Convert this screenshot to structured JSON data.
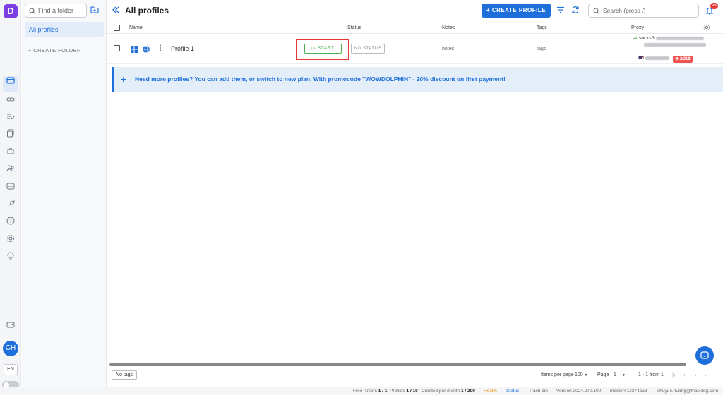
{
  "app": {
    "logo_letter": "D",
    "accent": "#1e6fd9"
  },
  "sidebar": {
    "icons": [
      "browser-profiles-icon",
      "link-icon",
      "list-check-icon",
      "copy-icon",
      "puzzle-icon",
      "users-icon",
      "api-icon",
      "rocket-icon",
      "help-icon",
      "settings-icon",
      "lightbulb-icon"
    ],
    "bottom_icons": [
      "wallet-icon"
    ],
    "avatar_initials": "CH",
    "language": "EN"
  },
  "folders": {
    "search_placeholder": "Find a folder",
    "all_profiles": "All profiles",
    "create_folder": "+ CREATE FOLDER"
  },
  "header": {
    "title": "All profiles",
    "create_profile": "+ CREATE PROFILE",
    "search_placeholder": "Search (press /)",
    "notifications_count": "26"
  },
  "table": {
    "columns": {
      "name": "Name",
      "status": "Status",
      "notes": "Notes",
      "tags": "Tags",
      "proxy": "Proxy"
    },
    "rows": [
      {
        "name": "Profile 1",
        "start_label": "START",
        "status": "NO STATUS",
        "notes": "notes",
        "tags": "tags",
        "proxy_type": "socks5",
        "proxy_badge": "2/318"
      }
    ]
  },
  "promo": {
    "text": "Need more profiles? You can add them, or switch to new plan. With promocode \"WOWDOLPHIN\" - 20% discount on first payment!"
  },
  "pagination": {
    "no_tags": "No tags",
    "items_per_page_label": "Items per page",
    "items_per_page": "100",
    "page_label": "Page",
    "page": "1",
    "range": "1 - 1 from 1"
  },
  "footer": {
    "plan": "Free",
    "users_label": "Users",
    "users": "1 / 1",
    "profiles_label": "Profiles",
    "profiles": "1 / 10",
    "created_label": "Created per month",
    "created": "1 / 200",
    "health": "Health",
    "status": "Status",
    "trash": "Trash bin",
    "version": "Version 2024.270.100",
    "build": "master#13374aa8",
    "email": "chuyue.huang@maskfog.com"
  }
}
